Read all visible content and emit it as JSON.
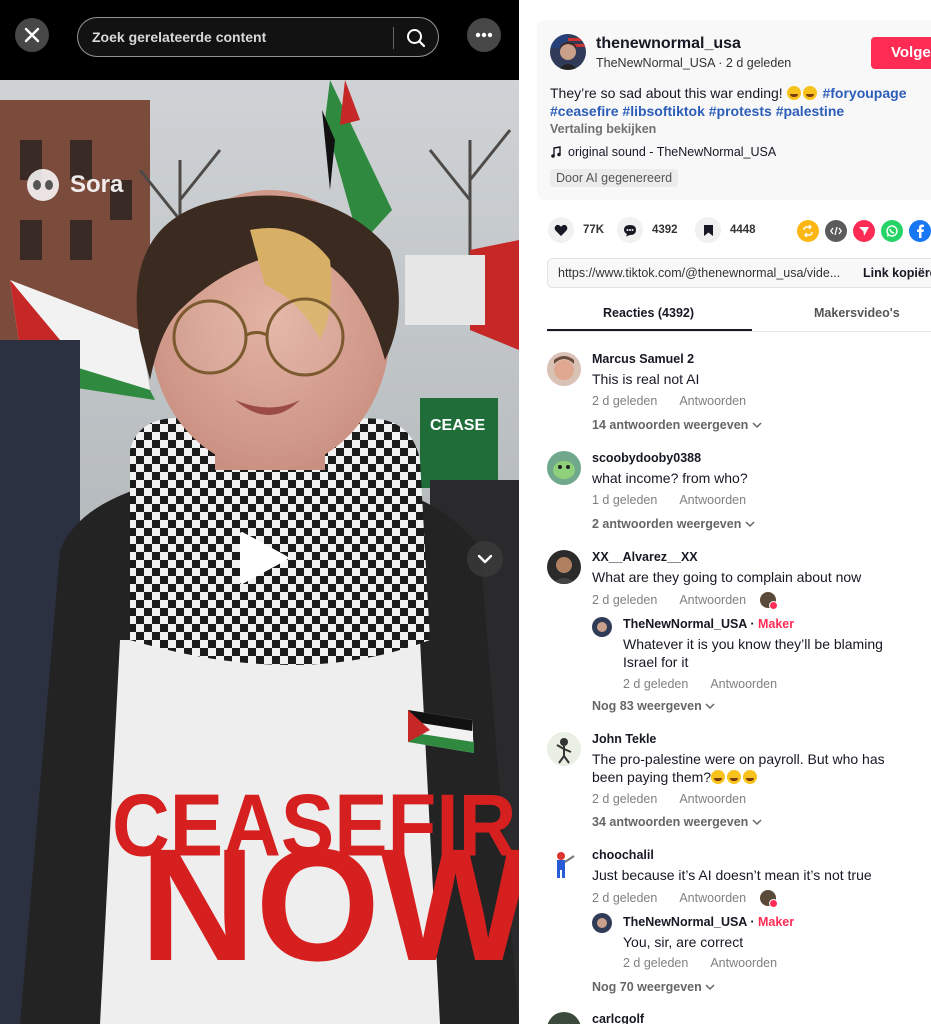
{
  "video": {
    "search_placeholder": "Zoek gerelateerde content",
    "watermark": "Sora",
    "sign_text": "CEASE",
    "shirt_line1": "CEASEFIRE",
    "shirt_line2": "NOW"
  },
  "post": {
    "username": "thenewnormal_usa",
    "subtitle": "TheNewNormal_USA · 2 d geleden",
    "follow_label": "Volger",
    "description_text": "They’re so sad about this war ending! ",
    "hashtags": [
      "#foryoupage",
      "#ceasefire",
      "#libsoftiktok",
      "#protests",
      "#palestine"
    ],
    "translate_label": "Vertaling bekijken",
    "sound": "original sound - TheNewNormal_USA",
    "ai_label": "Door AI gegenereerd"
  },
  "actions": {
    "likes": "77K",
    "comments": "4392",
    "saves": "4448"
  },
  "link": {
    "url": "https://www.tiktok.com/@thenewnormal_usa/vide...",
    "copy_label": "Link kopiëre"
  },
  "tabs": {
    "comments_tab": "Reacties (4392)",
    "creator_tab": "Makersvideo's"
  },
  "comments": [
    {
      "name": "Marcus Samuel 2",
      "text": "This is real not AI",
      "time": "2 d geleden",
      "reply": "Antwoorden",
      "more": "14 antwoorden weergeven"
    },
    {
      "name": "scoobydooby0388",
      "text": "what income? from who?",
      "time": "1 d geleden",
      "reply": "Antwoorden",
      "more": "2 antwoorden weergeven"
    },
    {
      "name": "XX__Alvarez__XX",
      "text": "What are they going to complain about now",
      "time": "2 d geleden",
      "reply": "Antwoorden",
      "sub": {
        "name": "TheNewNormal_USA",
        "badge": "Maker",
        "text": "Whatever it is you know they’ll be blaming Israel for it",
        "time": "2 d geleden",
        "reply": "Antwoorden"
      },
      "more": "Nog 83 weergeven"
    },
    {
      "name": "John Tekle",
      "text": "The pro-palestine were on payroll. But who has been paying them?",
      "time": "2 d geleden",
      "reply": "Antwoorden",
      "more": "34 antwoorden weergeven"
    },
    {
      "name": "choochalil",
      "text": "Just because it’s AI doesn’t mean it’s not true",
      "time": "2 d geleden",
      "reply": "Antwoorden",
      "sub": {
        "name": "TheNewNormal_USA",
        "badge": "Maker",
        "text": "You, sir, are correct",
        "time": "2 d geleden",
        "reply": "Antwoorden"
      },
      "more": "Nog 70 weergeven"
    },
    {
      "name": "carlcgolf"
    }
  ],
  "colors": {
    "accent": "#fe2c55",
    "hashtag": "#2b5db9",
    "text": "#161823",
    "muted": "#808080"
  }
}
